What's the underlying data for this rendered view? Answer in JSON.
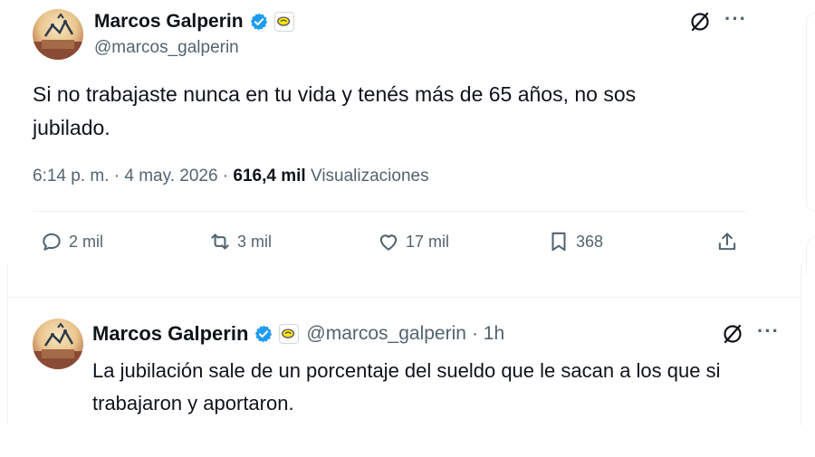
{
  "tweet": {
    "author": {
      "name": "Marcos Galperin",
      "handle": "@marcos_galperin"
    },
    "text": "Si no trabajaste nunca en tu vida y tenés más de 65 años, no sos jubilado.",
    "time": "6:14 p. m. · 4 may. 2026 ·",
    "views_count": "616,4 mil",
    "views_label": "Visualizaciones",
    "actions": {
      "replies": "2 mil",
      "retweets": "3 mil",
      "likes": "17 mil",
      "bookmarks": "368"
    }
  },
  "reply": {
    "author": {
      "name": "Marcos Galperin",
      "handle": "@marcos_galperin"
    },
    "time": "· 1h",
    "text": "La jubilación sale de un porcentaje del sueldo que le sacan a los que si trabajaron y aportaron."
  },
  "icons": {
    "verified": "verified-badge-icon",
    "affiliate": "affiliate-badge-icon",
    "grok": "grok-icon",
    "more": "more-icon",
    "reply": "reply-icon",
    "retweet": "retweet-icon",
    "like": "like-icon",
    "bookmark": "bookmark-icon",
    "share": "share-icon"
  },
  "colors": {
    "verified_blue": "#1d9bf0",
    "secondary_text": "#536471",
    "primary_text": "#0f1419",
    "divider": "#eff3f4"
  }
}
